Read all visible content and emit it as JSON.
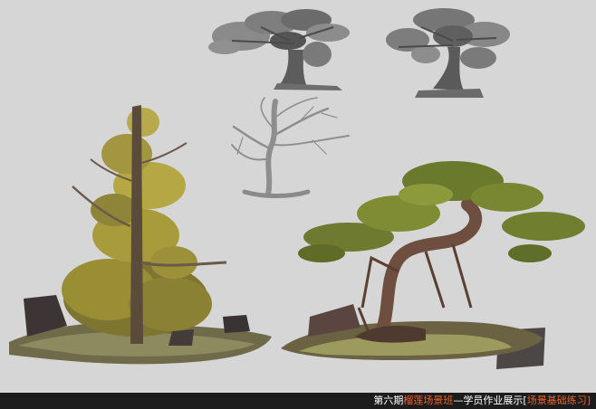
{
  "footer": {
    "prefix": "第六期",
    "highlight": "榴莲场景班",
    "middle": "—学员作业展示[",
    "tail": "场景基础练习]"
  },
  "colors": {
    "background": "#d6d6d6",
    "footer_bg": "#1c1c1c",
    "footer_text": "#ffffff",
    "footer_accent": "#e8622a",
    "accent_alt": "#c9c9c9"
  },
  "artworks": [
    {
      "name": "gray-value-tree-study-1"
    },
    {
      "name": "gray-value-tree-study-2"
    },
    {
      "name": "bare-branch-tree-sketch"
    },
    {
      "name": "pine-tree-color-study"
    },
    {
      "name": "twisted-bonsai-tree-color-study"
    }
  ]
}
